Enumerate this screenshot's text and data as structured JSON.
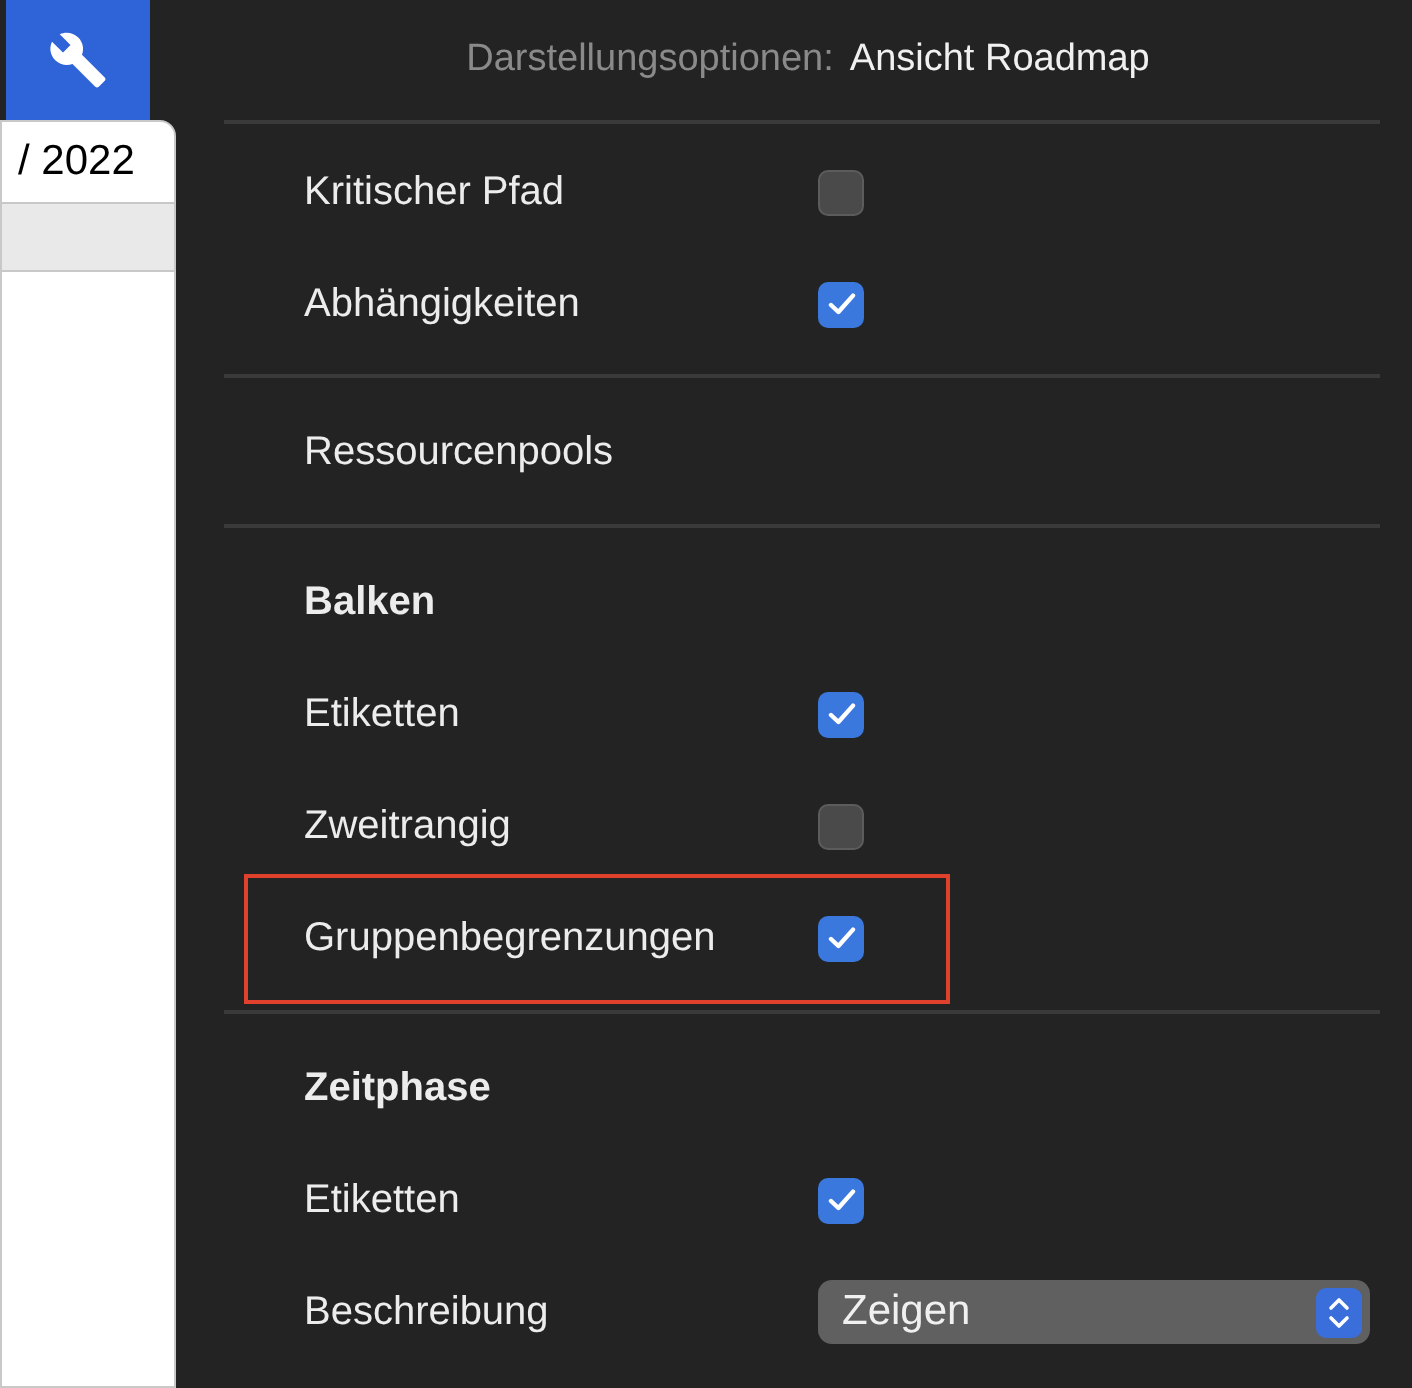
{
  "toolbar": {
    "tool_button": {
      "selected": true
    }
  },
  "side_panel": {
    "date_tab": "/ 2022"
  },
  "inspector": {
    "title_label": "Darstellungsoptionen:",
    "title_value": "Ansicht Roadmap",
    "sections": [
      {
        "items": [
          {
            "kind": "checkbox",
            "label": "Kritischer Pfad",
            "checked": false,
            "highlighted": false
          },
          {
            "kind": "checkbox",
            "label": "Abhängigkeiten",
            "checked": true,
            "highlighted": false
          }
        ]
      },
      {
        "items": [
          {
            "kind": "link",
            "label": "Ressourcenpools"
          }
        ]
      },
      {
        "items": [
          {
            "kind": "heading",
            "label": "Balken"
          },
          {
            "kind": "checkbox",
            "label": "Etiketten",
            "checked": true,
            "highlighted": false
          },
          {
            "kind": "checkbox",
            "label": "Zweitrangig",
            "checked": false,
            "highlighted": false
          },
          {
            "kind": "checkbox",
            "label": "Gruppenbegrenzungen",
            "checked": true,
            "highlighted": true
          }
        ]
      },
      {
        "items": [
          {
            "kind": "heading",
            "label": "Zeitphase"
          },
          {
            "kind": "checkbox",
            "label": "Etiketten",
            "checked": true,
            "highlighted": false
          },
          {
            "kind": "select",
            "label": "Beschreibung",
            "value": "Zeigen"
          }
        ]
      }
    ]
  }
}
